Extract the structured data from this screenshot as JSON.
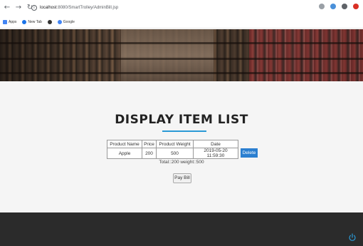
{
  "browser": {
    "url_host": "localhost",
    "url_rest": ":8080/SmartTrolley/AdminBill.jsp",
    "bookmarks": [
      {
        "label": "Apps",
        "color": "#4285f4"
      },
      {
        "label": "New Tab",
        "color": "#1a73e8"
      },
      {
        "label": "",
        "color": "#333333"
      },
      {
        "label": "Google",
        "color": "#4285f4"
      }
    ]
  },
  "page": {
    "title": "DISPLAY ITEM LIST",
    "table": {
      "headers": [
        "Product Name",
        "Price",
        "Product Weight",
        "Date"
      ],
      "rows": [
        [
          "Apple",
          "200",
          "500",
          "2019-05-20 11:59:30"
        ]
      ]
    },
    "delete_label": "Delete",
    "totals": "Total::200 weight::500",
    "pay_label": "Pay Bill"
  },
  "colors": {
    "accent": "#2b9ad6",
    "button": "#2b7fd0",
    "footer": "#2b2b2b"
  }
}
